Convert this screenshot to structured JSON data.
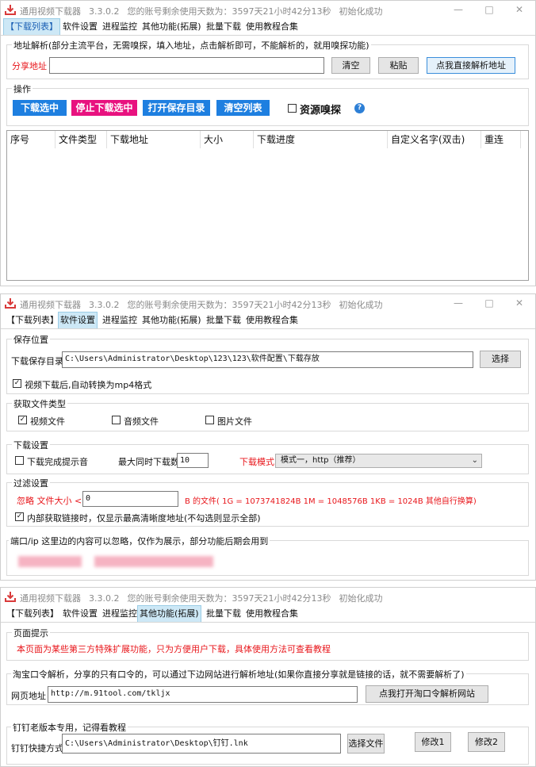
{
  "window": {
    "title": "通用视频下载器",
    "version": "3.3.0.2",
    "remaining": "您的账号剩余使用天数为：3597天21小时42分13秒",
    "status": "初始化成功",
    "minimize": "—",
    "maximize": "□",
    "close": "✕"
  },
  "tabs": [
    "【下载列表】",
    "软件设置",
    "进程监控",
    "其他功能(拓展)",
    "批量下载",
    "使用教程合集"
  ],
  "panel1": {
    "parse_group": "地址解析(部分主流平台，无需嗅探，填入地址，点击解析即可，不能解析的，就用嗅探功能)",
    "share_label": "分享地址",
    "share_value": "",
    "clear": "清空",
    "paste": "粘贴",
    "direct_parse": "点我直接解析地址",
    "ops_group": "操作",
    "download_selected": "下载选中",
    "stop_selected": "停止下载选中",
    "open_dir": "打开保存目录",
    "clear_list": "清空列表",
    "sniff": "资源嗅探",
    "help": "?",
    "columns": [
      "序号",
      "文件类型",
      "下载地址",
      "大小",
      "下载进度",
      "自定义名字(双击)",
      "重连"
    ]
  },
  "panel2": {
    "save_group": "保存位置",
    "save_label": "下载保存目录",
    "save_path": "C:\\Users\\Administrator\\Desktop\\123\\123\\软件配置\\下载存放",
    "choose": "选择",
    "convert_mp4": "视频下载后,自动转换为mp4格式",
    "filetype_group": "获取文件类型",
    "video": "视频文件",
    "audio": "音频文件",
    "image": "图片文件",
    "dl_group": "下载设置",
    "done_sound": "下载完成提示音",
    "max_label": "最大同时下载数",
    "max_value": "10",
    "mode_label": "下载模式",
    "mode_value": "模式一，http（推荐）",
    "filter_group": "过滤设置",
    "ignore_label": "忽略  文件大小 <",
    "ignore_value": "0",
    "size_note": "B 的文件(   1G = 1073741824B     1M = 1048576B  1KB = 1024B    其他自行换算)",
    "inner_link": "内部获取链接时，仅显示最高清晰度地址(不勾选则显示全部)",
    "port_group": "端口/ip 这里边的内容可以忽略，仅作为展示，部分功能后期会用到"
  },
  "panel3": {
    "hint_group": "页面提示",
    "hint_text": "本页面为某些第三方特殊扩展功能，只为方便用户下载，具体使用方法可查看教程",
    "taobao_group": "淘宝口令解析，分享的只有口令的，可以通过下边网站进行解析地址(如果你直接分享就是链接的话，就不需要解析了)",
    "url_label": "网页地址",
    "url_value": "http://m.91tool.com/tkljx",
    "open_site": "点我打开淘口令解析网站",
    "dingding_group": "钉钉老版本专用，记得看教程",
    "shortcut_label": "钉钉快捷方式",
    "shortcut_value": "C:\\Users\\Administrator\\Desktop\\钉钉.lnk",
    "choose_file": "选择文件",
    "modify1": "修改1",
    "modify2": "修改2"
  },
  "colors": {
    "download_selected": "#1e7fe0",
    "stop_selected": "#e8127f",
    "open_dir": "#1e7fe0",
    "clear_list": "#1e7fe0",
    "red_text": "#e8161b",
    "tab_active": "#cde8f6"
  }
}
